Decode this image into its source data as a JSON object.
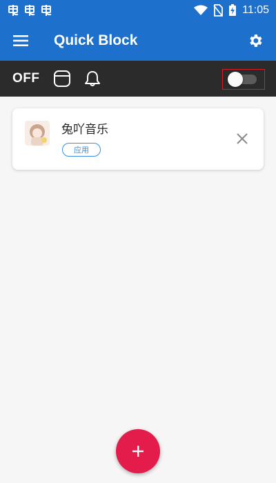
{
  "status_bar": {
    "time": "11:05",
    "left_icons": [
      "bug-icon",
      "bug-icon",
      "bug-icon"
    ],
    "right_icons": [
      "wifi-icon",
      "no-sim-icon",
      "battery-icon"
    ]
  },
  "app_bar": {
    "title": "Quick Block",
    "menu_icon": "hamburger-menu-icon",
    "settings_icon": "gear-icon",
    "color": "#1e70cd"
  },
  "toolbar": {
    "status_label": "OFF",
    "icons": [
      "phone-frame-icon",
      "bell-icon"
    ],
    "switch_on": false
  },
  "blocked_list": [
    {
      "name": "兔吖音乐",
      "tag": "应用"
    }
  ],
  "fab": {
    "icon": "plus-icon",
    "color": "#e31c4b"
  }
}
